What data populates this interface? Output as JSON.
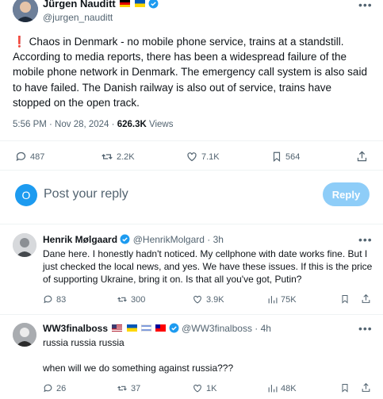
{
  "main_post": {
    "author_name": "Jürgen Nauditt",
    "handle": "@jurgen_nauditt",
    "body": "Chaos in Denmark - no mobile phone service, trains at a standstill. According to media reports, there has been a widespread failure of the mobile phone network in Denmark. The emergency call system is also said to have failed. The Danish railway is also out of service, trains have stopped on the open track.",
    "timestamp": "5:56 PM · Nov 28, 2024 ·",
    "views_count": "626.3K",
    "views_label": "Views",
    "stats": {
      "replies": "487",
      "reposts": "2.2K",
      "likes": "7.1K",
      "bookmarks": "564"
    }
  },
  "composer": {
    "avatar_letter": "O",
    "placeholder": "Post your reply",
    "button_label": "Reply"
  },
  "replies": [
    {
      "author_name": "Henrik Mølgaard",
      "handle": "@HenrikMolgard",
      "time": "· 3h",
      "body": "Dane here. I honestly hadn't noticed. My cellphone with date works fine. But I just checked the local news, and yes. We have these issues. If this is the price of supporting Ukraine, bring it on. Is that all you've got, Putin?",
      "stats": {
        "replies": "83",
        "reposts": "300",
        "likes": "3.9K",
        "views": "75K"
      }
    },
    {
      "author_name": "WW3finalboss",
      "handle": "@WW3finalboss",
      "time": "· 4h",
      "body_line1": "russia russia russia",
      "body_line2": "when will we do something against russia???",
      "stats": {
        "replies": "26",
        "reposts": "37",
        "likes": "1K",
        "views": "48K"
      }
    }
  ],
  "colors": {
    "accent": "#1d9bf0",
    "reply_button_disabled": "#8ecdf8",
    "alert_red": "#e0245e",
    "text_secondary": "#536471"
  }
}
